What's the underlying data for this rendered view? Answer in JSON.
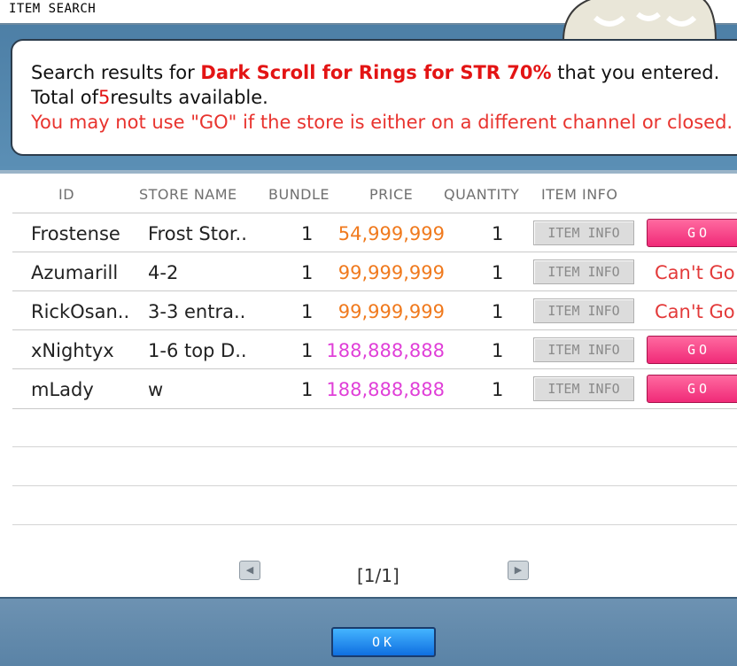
{
  "window": {
    "title": "ITEM SEARCH"
  },
  "message": {
    "prefix": "Search results for ",
    "item_name": "Dark Scroll for Rings for STR 70%",
    "suffix": " that you entered.",
    "total_prefix": "Total of",
    "total_count": "5",
    "total_suffix": "results available.",
    "warning": "You may not use \"GO\" if the store is either on a different channel or closed."
  },
  "columns": {
    "id": "ID",
    "store_name": "STORE NAME",
    "bundle": "BUNDLE",
    "price": "PRICE",
    "quantity": "QUANTITY",
    "item_info": "ITEM INFO"
  },
  "rows": [
    {
      "id": "Frostense",
      "store": "Frost Stor..",
      "bundle": "1",
      "price": "54,999,999",
      "qty": "1",
      "info": "ITEM INFO",
      "action": "GO"
    },
    {
      "id": "Azumarill",
      "store": "4-2",
      "bundle": "1",
      "price": "99,999,999",
      "qty": "1",
      "info": "ITEM INFO",
      "action": "Can't Go"
    },
    {
      "id": "RickOsan..",
      "store": "3-3 entra..",
      "bundle": "1",
      "price": "99,999,999",
      "qty": "1",
      "info": "ITEM INFO",
      "action": "Can't Go"
    },
    {
      "id": "xNightyx",
      "store": "1-6 top D..",
      "bundle": "1",
      "price": "188,888,888",
      "qty": "1",
      "info": "ITEM INFO",
      "action": "GO"
    },
    {
      "id": "mLady",
      "store": "w",
      "bundle": "1",
      "price": "188,888,888",
      "qty": "1",
      "info": "ITEM INFO",
      "action": "GO"
    }
  ],
  "pager": {
    "text": "[1/1]",
    "prev_icon": "arrow-left-icon",
    "next_icon": "arrow-right-icon"
  },
  "footer": {
    "ok_label": "OK"
  },
  "colors": {
    "price_low": "#f07a1e",
    "price_high": "#e040d8",
    "go_button": "#f02a78",
    "warning": "#e33a3a"
  }
}
